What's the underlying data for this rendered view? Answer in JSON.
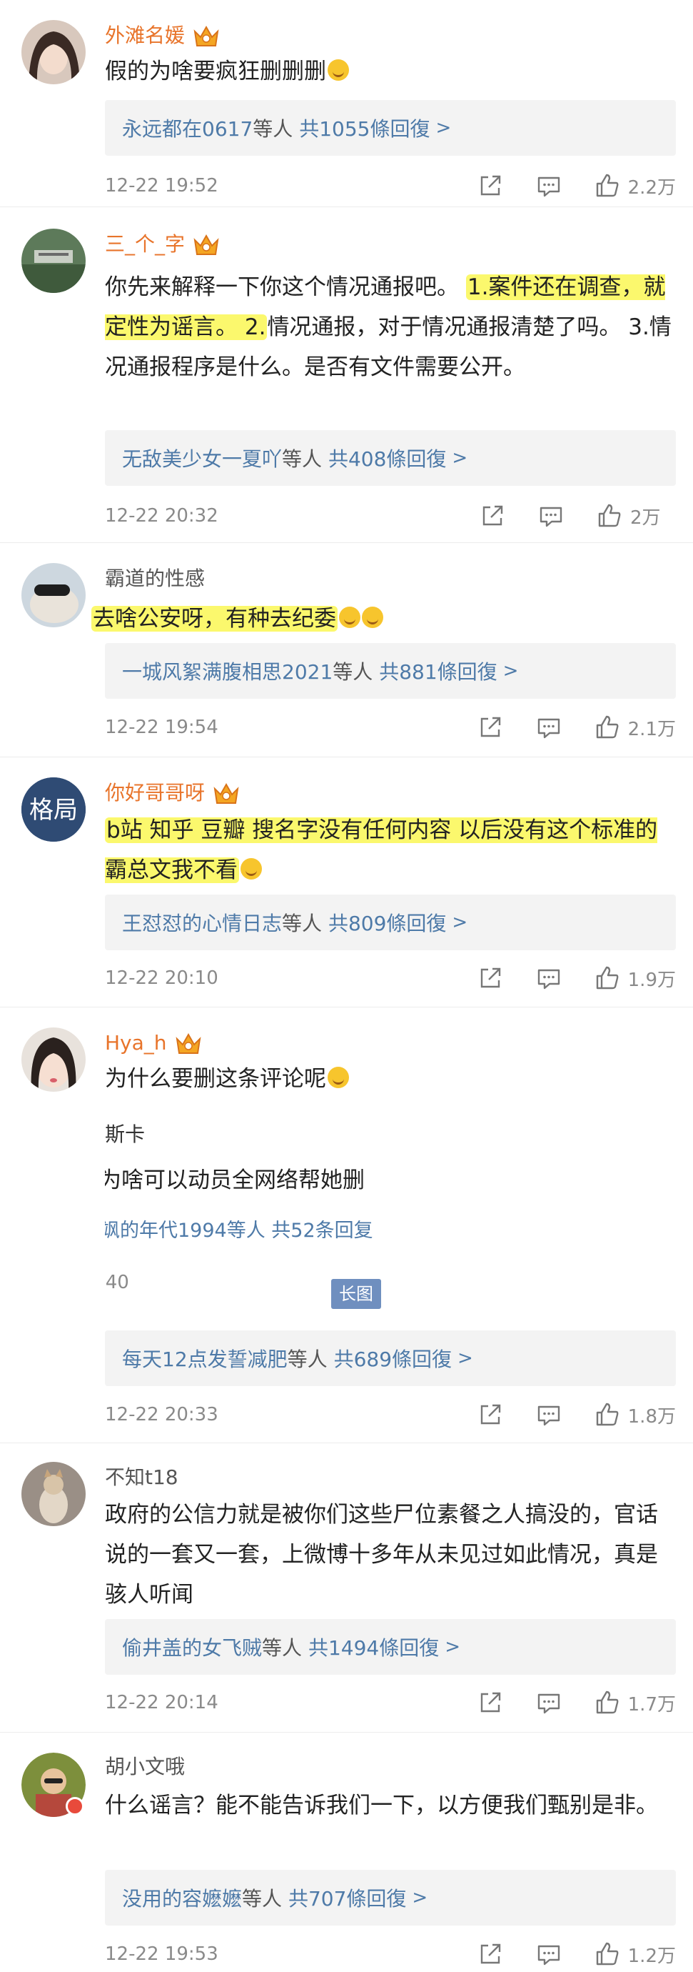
{
  "comments": [
    {
      "username": "外滩名媛",
      "text": "假的为啥要疯狂删删删",
      "replies": {
        "names": "永远都在0617",
        "mid": "等人",
        "count": "共1055條回復",
        "chevron": ">"
      },
      "time": "12-22 19:52",
      "likes": "2.2万"
    },
    {
      "username": "三_个_字",
      "text_parts": [
        "你先来解释一下你这个情况通报吧。 ",
        "1.案件还在调查，就定性为谣言。 2.",
        "情况通报，对于情况通报清楚了吗。 3.情况通报程序是什么。是否有文件需要公开。"
      ],
      "replies": {
        "names": "无敌美少女一夏吖",
        "mid": "等人",
        "count": "共408條回復",
        "chevron": ">"
      },
      "time": "12-22 20:32",
      "likes": "2万"
    },
    {
      "username": "霸道的性感",
      "text": "去啥公安呀，有种去纪委",
      "replies": {
        "names": "一城风絮满腹相思2021",
        "mid": "等人",
        "count": "共881條回復",
        "chevron": ">"
      },
      "time": "12-22 19:54",
      "likes": "2.1万"
    },
    {
      "username": "你好哥哥呀",
      "avatar_text": "格局",
      "text": "b站 知乎 豆瓣 搜名字没有任何内容 以后没有这个标准的霸总文我不看",
      "replies": {
        "names": "王怼怼的心情日志",
        "mid": "等人",
        "count": "共809條回復",
        "chevron": ">"
      },
      "time": "12-22 20:10",
      "likes": "1.9万"
    },
    {
      "username": "Hya_h",
      "text": "为什么要删这条评论呢",
      "quote": {
        "name": "斯卡",
        "text": "为啥可以动员全网络帮她删",
        "replies": "飒的年代1994等人  共52条回复",
        "time": ":40",
        "badge": "长图"
      },
      "replies": {
        "names": "每天12点发誓减肥",
        "mid": "等人",
        "count": "共689條回復",
        "chevron": ">"
      },
      "time": "12-22 20:33",
      "likes": "1.8万"
    },
    {
      "username": "不知t18",
      "text": "政府的公信力就是被你们这些尸位素餐之人搞没的，官话说的一套又一套，上微博十多年从未见过如此情况，真是骇人听闻",
      "replies": {
        "names": "偷井盖的女飞贼",
        "mid": "等人",
        "count": "共1494條回復",
        "chevron": ">"
      },
      "time": "12-22 20:14",
      "likes": "1.7万"
    },
    {
      "username": "胡小文哦",
      "text": "什么谣言？能不能告诉我们一下，以方便我们甄别是非。",
      "replies": {
        "names": "没用的容嬷嬷",
        "mid": "等人",
        "count": "共707條回復",
        "chevron": ">"
      },
      "time": "12-22 19:53",
      "likes": "1.2万"
    }
  ],
  "colors": {
    "vip_name": "#e8742b",
    "link": "#4e7aa8",
    "meta": "#8a8a8a",
    "highlight": "#faf53c",
    "reply_bg": "#f3f3f3"
  },
  "icons": [
    "crown-icon",
    "share-icon",
    "comment-icon",
    "like-icon",
    "grin-emoji-icon"
  ]
}
